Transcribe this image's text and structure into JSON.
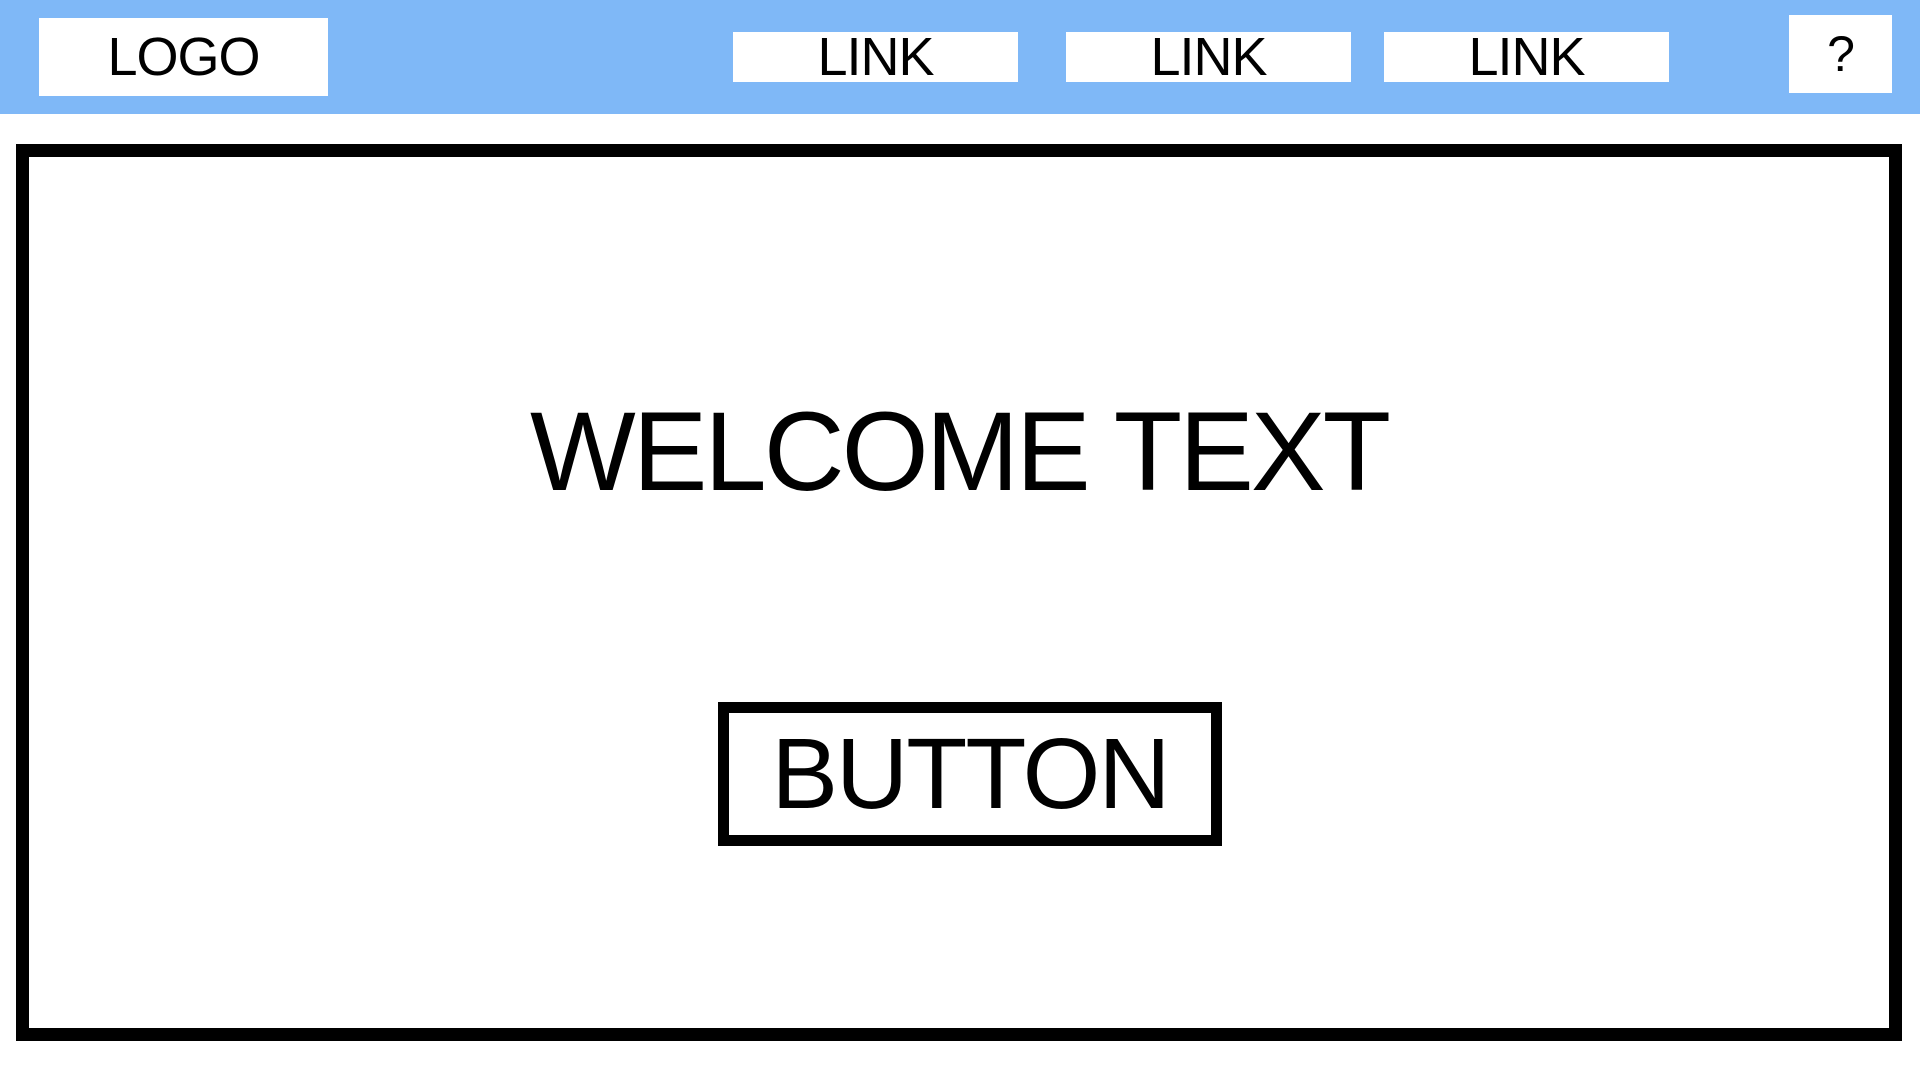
{
  "header": {
    "background_color": "#7fb8f7",
    "logo": "LOGO",
    "links": [
      {
        "label": "LINK"
      },
      {
        "label": "LINK"
      },
      {
        "label": "LINK"
      }
    ],
    "help_label": "?"
  },
  "main": {
    "welcome_text": "WELCOME TEXT",
    "button_label": "BUTTON"
  }
}
